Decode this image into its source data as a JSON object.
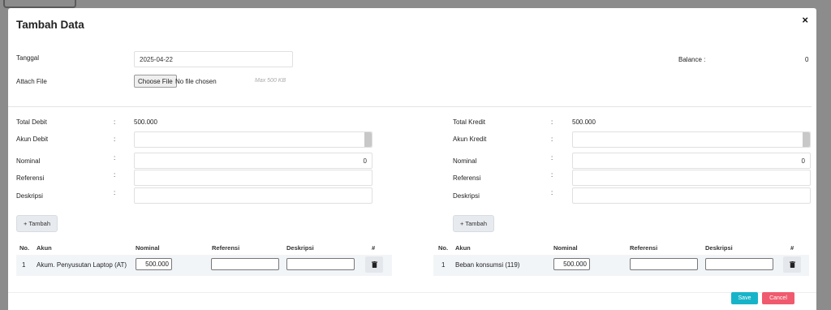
{
  "modal": {
    "title": "Tambah Data",
    "close_label": "×"
  },
  "form": {
    "tanggal_label": "Tanggal",
    "tanggal_value": "2025-04-22",
    "attach_label": "Attach File",
    "choose_file_label": "Choose File",
    "no_file_text": "No file chosen",
    "max_size_hint": "Max 500 KB",
    "balance_label": "Balance :",
    "balance_value": "0"
  },
  "debit": {
    "total_label": "Total Debit",
    "total_value": "500.000",
    "akun_label": "Akun Debit",
    "nominal_label": "Nominal",
    "nominal_value": "0",
    "referensi_label": "Referensi",
    "deskripsi_label": "Deskripsi",
    "add_label": "+ Tambah",
    "headers": [
      "No.",
      "Akun",
      "Nominal",
      "Referensi",
      "Deskripsi",
      "#"
    ],
    "rows": [
      {
        "no": "1",
        "akun": "Akum. Penyusutan Laptop (AT)",
        "nominal": "500.000",
        "referensi": "",
        "deskripsi": ""
      }
    ]
  },
  "kredit": {
    "total_label": "Total Kredit",
    "total_value": "500.000",
    "akun_label": "Akun Kredit",
    "nominal_label": "Nominal",
    "nominal_value": "0",
    "referensi_label": "Referensi",
    "deskripsi_label": "Deskripsi",
    "add_label": "+ Tambah",
    "headers": [
      "No.",
      "Akun",
      "Nominal",
      "Referensi",
      "Deskripsi",
      "#"
    ],
    "rows": [
      {
        "no": "1",
        "akun": "Beban konsumsi (119)",
        "nominal": "500.000",
        "referensi": "",
        "deskripsi": ""
      }
    ]
  },
  "colon": ":",
  "footer": {
    "save_label": "Save",
    "cancel_label": "Cancel"
  },
  "colors": {
    "save": "#17b4c9",
    "cancel": "#f05a6e",
    "row_bg": "#f2f5f8"
  },
  "icons": {
    "delete": "trash-icon",
    "close": "close-icon"
  }
}
